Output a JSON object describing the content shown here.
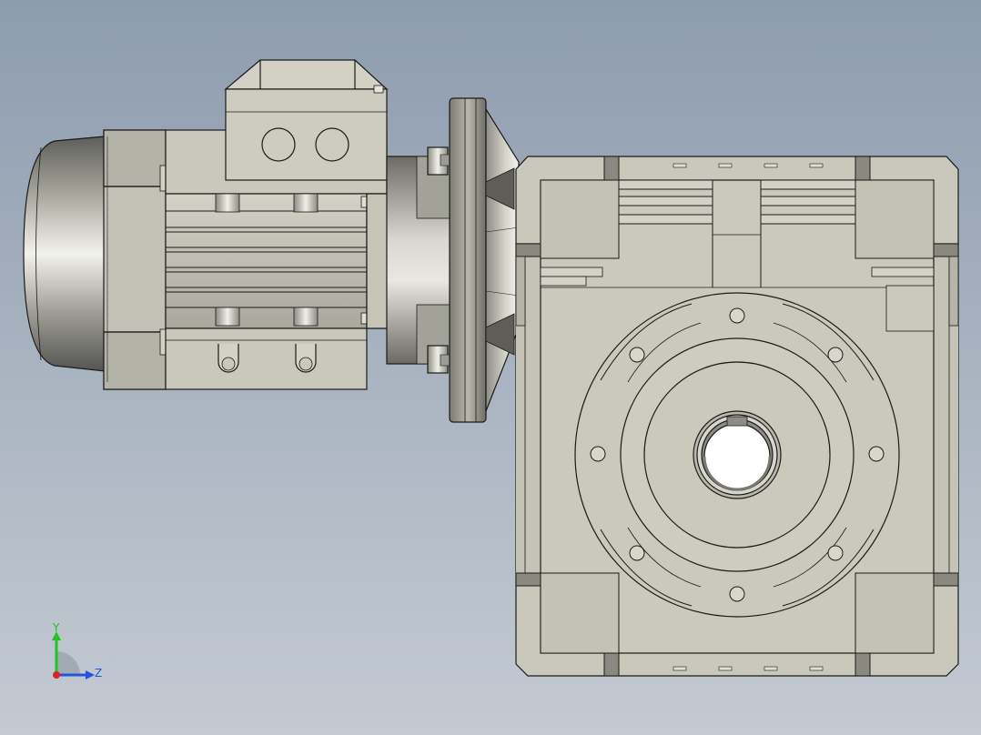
{
  "view": {
    "background_top": "#8d9caf",
    "background_bottom": "#c4cad2",
    "part_fill": "#c9c8bb",
    "part_shade": "#a9a89c",
    "edge_color": "#1a1a1a"
  },
  "triad": {
    "y_label": "Y",
    "z_label": "Z",
    "y_color": "#22c322",
    "z_color": "#2255dd",
    "x_color": "#dd2222"
  }
}
